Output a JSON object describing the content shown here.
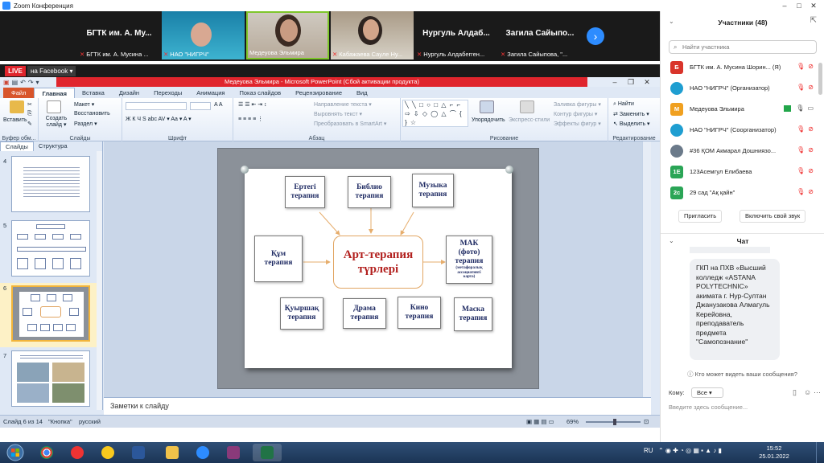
{
  "zoom": {
    "window_title": "Zoom Конференция",
    "tiles": [
      {
        "name": "БГТК им. А. Му...",
        "label": "БГТК им. А. Мусина ..."
      },
      {
        "label": "НАО \"НИГРЧ\""
      },
      {
        "label": "Медеуова Эльмира"
      },
      {
        "label": "Кабажаева Сауле Ну..."
      },
      {
        "name": "Нургуль Алдаб...",
        "label": "Нургуль Алдабеrген..."
      },
      {
        "name": "Загила Сайыпо...",
        "label": "Загила Сайыпова, \"..."
      }
    ],
    "next_icon": "›",
    "live": "LIVE",
    "facebook": "на Facebook ▾"
  },
  "ppt": {
    "title": "Медеуова Эльмира - Microsoft PowerPoint (Сбой активации продукта)",
    "tabs": [
      "Файл",
      "Главная",
      "Вставка",
      "Дизайн",
      "Переходы",
      "Анимация",
      "Показ слайдов",
      "Рецензирование",
      "Вид"
    ],
    "ribbon": {
      "paste": "Вставить",
      "clipboard": "Буфер обм...",
      "layout": "Макет ▾",
      "reset": "Восстановить",
      "section": "Раздел ▾",
      "new_slide": "Создать слайд ▾",
      "slides_group": "Слайды",
      "font_group": "Шрифт",
      "font_styles": "Ж  К  Ч  S  abc  AV ▾  Aa ▾  A ▾",
      "para_group": "Абзац",
      "text_direction": "Направление текста ▾",
      "align_text": "Выровнять текст ▾",
      "smartart": "Преобразовать в SmartArt ▾",
      "arrange": "Упорядочить",
      "quick_styles": "Экспресс-стили",
      "fill": "Заливка фигуры ▾",
      "outline": "Контур фигуры ▾",
      "effects": "Эффекты фигур ▾",
      "drawing_group": "Рисование",
      "find": "Найти",
      "replace": "Заменить ▾",
      "select": "Выделить ▾",
      "editing_group": "Редактирование",
      "shapes": "╲ ╲ □ ○ □ △ ⌐ ⌐ ⇨ ⇩ ◇ ◯ △ ⌒ { } ☆"
    },
    "pane_tabs": [
      "Слайды",
      "Структура"
    ],
    "thumbs": [
      {
        "num": "4"
      },
      {
        "num": "5"
      },
      {
        "num": "6"
      },
      {
        "num": "7"
      }
    ],
    "slide": {
      "center": [
        "Арт-терапия",
        "түрлері"
      ],
      "nodes": {
        "ertegi": [
          "Ертегі",
          "терапия"
        ],
        "biblio": [
          "Библио",
          "терапия"
        ],
        "muzyka": [
          "Музыка",
          "терапия"
        ],
        "kum": [
          "Құм",
          "терапия"
        ],
        "mak": [
          "МАК",
          "(фото)",
          "терапия"
        ],
        "mak_note": [
          "(метафоралық",
          "ассоциативті",
          "карта)"
        ],
        "kuyrshak": [
          "Қуыршақ",
          "терапия"
        ],
        "drama": [
          "Драма",
          "терапия"
        ],
        "kino": [
          "Кино",
          "терапия"
        ],
        "maska": [
          "Маска",
          "терапия"
        ]
      }
    },
    "notes_placeholder": "Заметки к слайду",
    "status": {
      "slide_of": "Слайд 6 из 14",
      "theme": "\"Кнопка\"",
      "lang": "русский",
      "zoom": "69%"
    }
  },
  "participants": {
    "title": "Участники (48)",
    "search_placeholder": "Найти участника",
    "list": [
      {
        "avatar": "Б",
        "color": "#d9342b",
        "name": "БГТК им. А. Мусина Шорин... (Я)"
      },
      {
        "avatar": "",
        "color": "#1f9ed1",
        "name": "НАО \"НИГРЧ\" (Организатор)"
      },
      {
        "avatar": "М",
        "color": "#f0a020",
        "name": "Медеуова Эльмира"
      },
      {
        "avatar": "",
        "color": "#1f9ed1",
        "name": "НАО \"НИГРЧ\" (Соорганизатор)"
      },
      {
        "avatar": "",
        "color": "#6b7a8a",
        "name": "#36 ҚОМ Акмарал Дошниязо..."
      },
      {
        "avatar": "1E",
        "color": "#2aa556",
        "name": "123Асемгул Елибаева"
      },
      {
        "avatar": "2с",
        "color": "#2aa556",
        "name": "29 сад \"Ақ қайн\""
      }
    ],
    "invite": "Пригласить",
    "unmute": "Включить свой звук"
  },
  "chat": {
    "title": "Чат",
    "message": "ГКП на ПХВ «Высший колледж «ASTANA POLYTECHNIC» акимата г. Нур-Султан Джанузакова Алмагуль Керейовна, преподаватель предмета \"Самопознание\"",
    "who_can_see": "Кто может видеть ваши сообщения?",
    "to_label": "Кому:",
    "to_value": "Все ▾",
    "input_placeholder": "Введите здесь сообщение..."
  },
  "taskbar": {
    "lang": "RU",
    "time": "15:52",
    "date": "25.01.2022"
  }
}
